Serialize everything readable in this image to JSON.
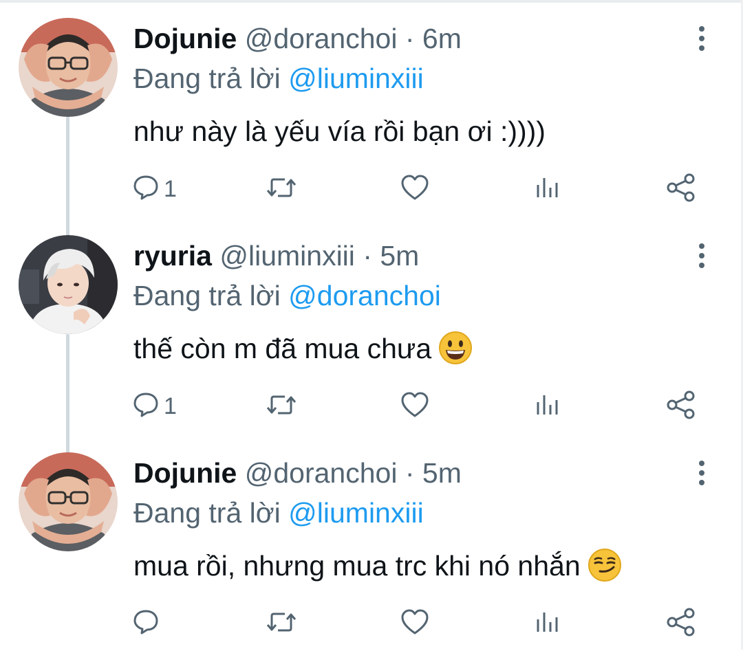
{
  "thread": {
    "tweets": [
      {
        "display_name": "Dojunie",
        "handle": "@doranchoi",
        "separator": "·",
        "time": "6m",
        "reply_prefix": "Đang trả lời",
        "reply_to": "@liuminxiii",
        "text": "như này là yếu vía rồi bạn ơi :))))",
        "emoji": "",
        "reply_count": "1",
        "avatar_icon": "avatar-heart-hands"
      },
      {
        "display_name": "ryuria",
        "handle": "@liuminxiii",
        "separator": "·",
        "time": "5m",
        "reply_prefix": "Đang trả lời",
        "reply_to": "@doranchoi",
        "text": "thế còn m đã mua chưa",
        "emoji": "grinning-face",
        "reply_count": "1",
        "avatar_icon": "avatar-white-hair"
      },
      {
        "display_name": "Dojunie",
        "handle": "@doranchoi",
        "separator": "·",
        "time": "5m",
        "reply_prefix": "Đang trả lời",
        "reply_to": "@liuminxiii",
        "text": "mua rồi, nhưng mua trc khi nó nhắn",
        "emoji": "smirking-face",
        "reply_count": "",
        "avatar_icon": "avatar-heart-hands"
      }
    ]
  },
  "icons": {
    "reply": "reply-icon",
    "retweet": "retweet-icon",
    "like": "like-icon",
    "views": "views-icon",
    "share": "share-icon",
    "more": "more-icon"
  },
  "colors": {
    "text": "#0f1419",
    "secondary": "#536471",
    "mention": "#1d9bf0",
    "thread_line": "#cfd9de",
    "emoji_yellow": "#f7c33a"
  }
}
